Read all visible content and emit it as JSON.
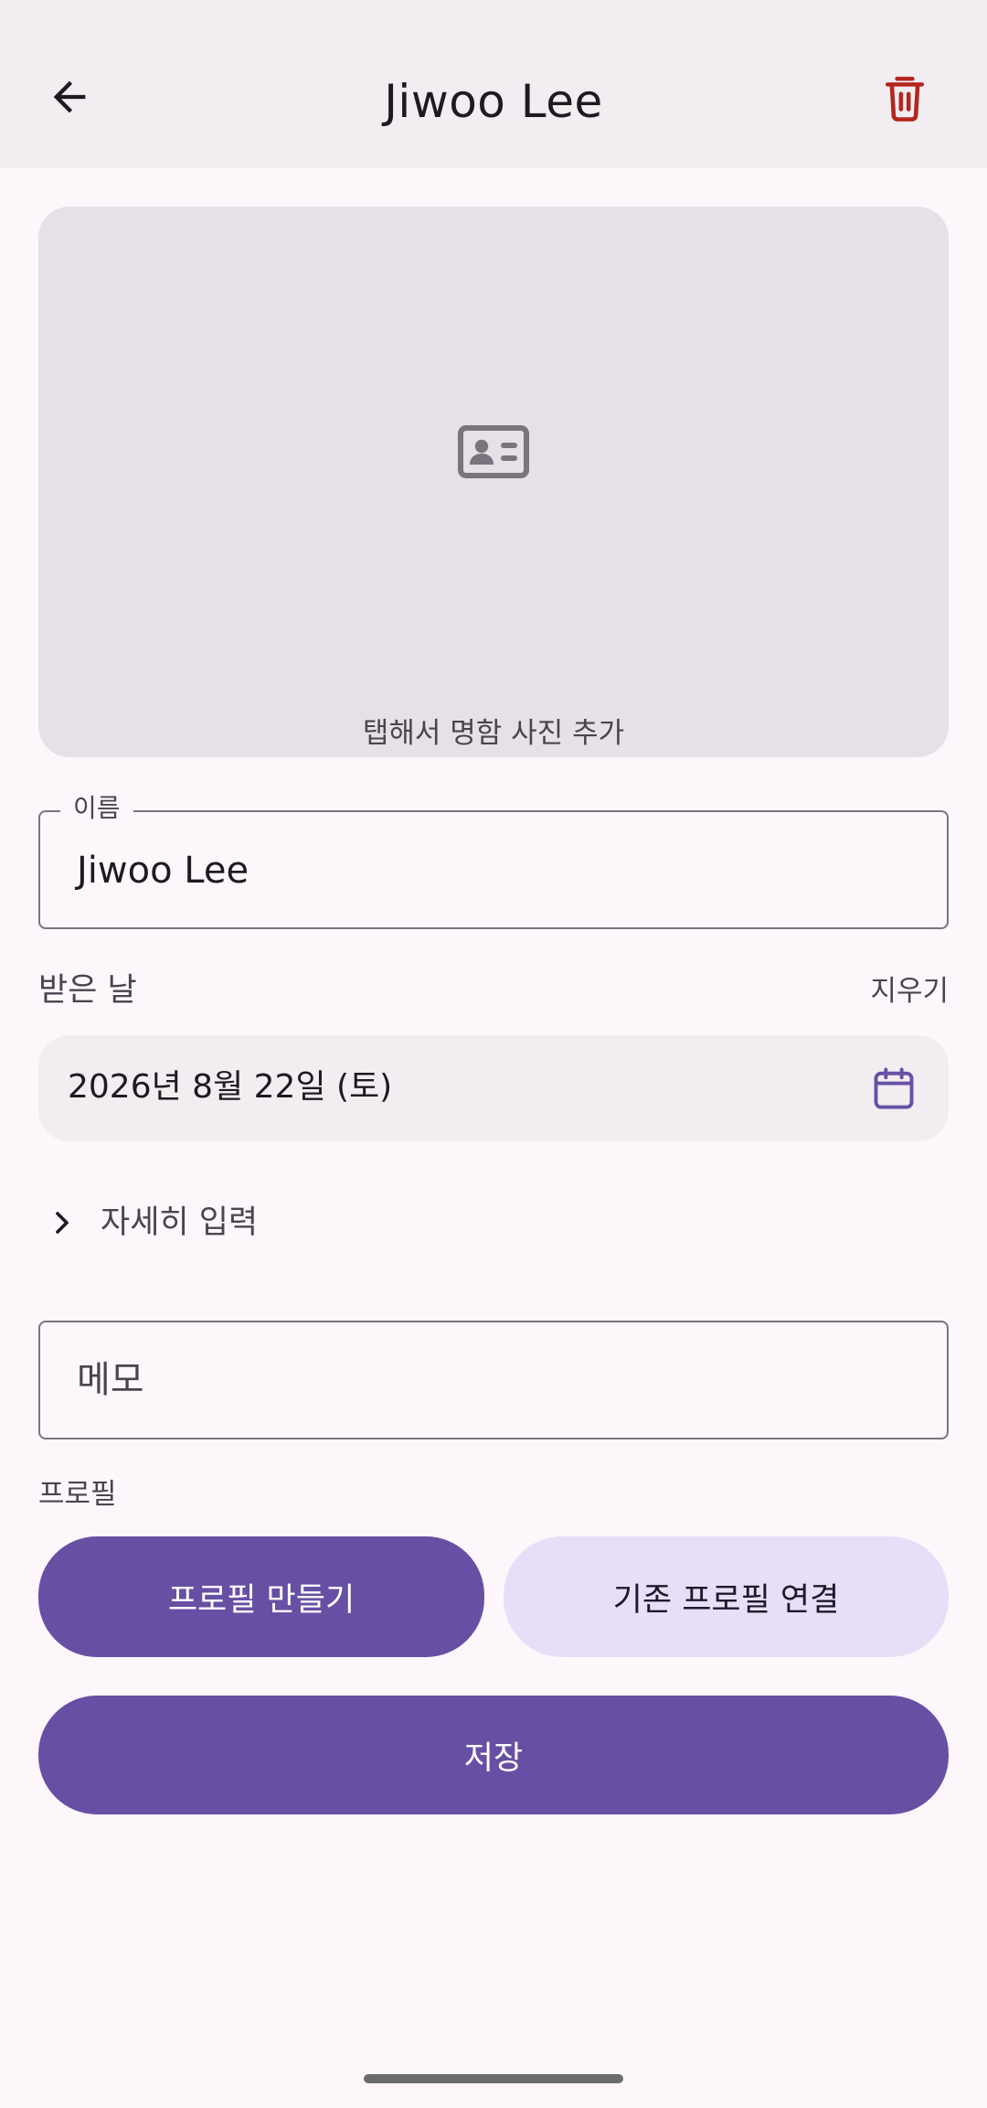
{
  "app_bar": {
    "title": "Jiwoo Lee",
    "back_icon": "arrow-left-icon",
    "delete_icon": "trash-icon",
    "delete_color": "#b3261e"
  },
  "photo": {
    "icon": "id-card-icon",
    "hint": "탭해서 명함 사진 추가"
  },
  "name_field": {
    "label": "이름",
    "value": "Jiwoo Lee"
  },
  "received_date": {
    "label": "받은 날",
    "clear_label": "지우기",
    "value": "2026년 8월 22일 (토)",
    "icon": "calendar-icon"
  },
  "details": {
    "label": "자세히 입력",
    "icon": "chevron-right-icon"
  },
  "memo": {
    "placeholder": "메모"
  },
  "profile": {
    "label": "프로필",
    "create_label": "프로필 만들기",
    "link_label": "기존 프로필 연결"
  },
  "save_label": "저장",
  "colors": {
    "primary": "#6750a4",
    "secondary_container": "#e8def8",
    "surface": "#fdf7fc",
    "app_bar": "#f2edf1"
  }
}
